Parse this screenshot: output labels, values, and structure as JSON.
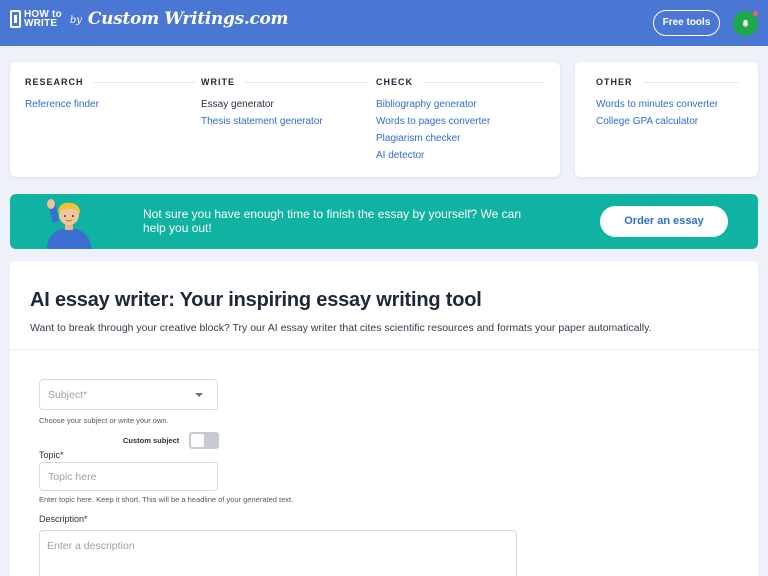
{
  "header": {
    "logo_line1": "HOW to",
    "logo_line2": "WRITE",
    "logo_by": "by",
    "logo_brand": "Custom Writings.com",
    "free_tools_label": "Free tools",
    "avatar_icon": "bell-icon",
    "colors": {
      "bar": "#4a76d4",
      "avatar": "#1fa84a",
      "notification_dot": "#f26a3d"
    }
  },
  "menu": {
    "research": {
      "heading": "RESEARCH",
      "items": [
        "Reference finder"
      ]
    },
    "write": {
      "heading": "WRITE",
      "items": [
        "Essay generator",
        "Thesis statement generator"
      ]
    },
    "check": {
      "heading": "CHECK",
      "items": [
        "Bibliography generator",
        "Words to pages converter",
        "Plagiarism checker",
        "AI detector"
      ]
    },
    "other": {
      "heading": "OTHER",
      "items": [
        "Words to minutes converter",
        "College GPA calculator"
      ]
    }
  },
  "banner": {
    "icon": "raising-hand-icon",
    "text": "Not sure you have enough time to finish the essay by yourself? We can help you out!",
    "button_label": "Order an essay",
    "color": "#10b3a2"
  },
  "main": {
    "title": "AI essay writer: Your inspiring essay writing tool",
    "subtitle": "Want to break through your creative block? Try our AI essay writer that cites scientific resources and formats your paper automatically."
  },
  "form": {
    "subject": {
      "placeholder": "Subject*",
      "hint": "Choose your subject or write your own.",
      "icon": "chevron-down-icon"
    },
    "custom_subject": {
      "label": "Custom subject",
      "enabled": false
    },
    "topic": {
      "label": "Topic*",
      "placeholder": "Topic here",
      "hint": "Enter topic here. Keep it short. This will be a headline of your generated text."
    },
    "description": {
      "label": "Description*",
      "placeholder": "Enter a description"
    }
  }
}
